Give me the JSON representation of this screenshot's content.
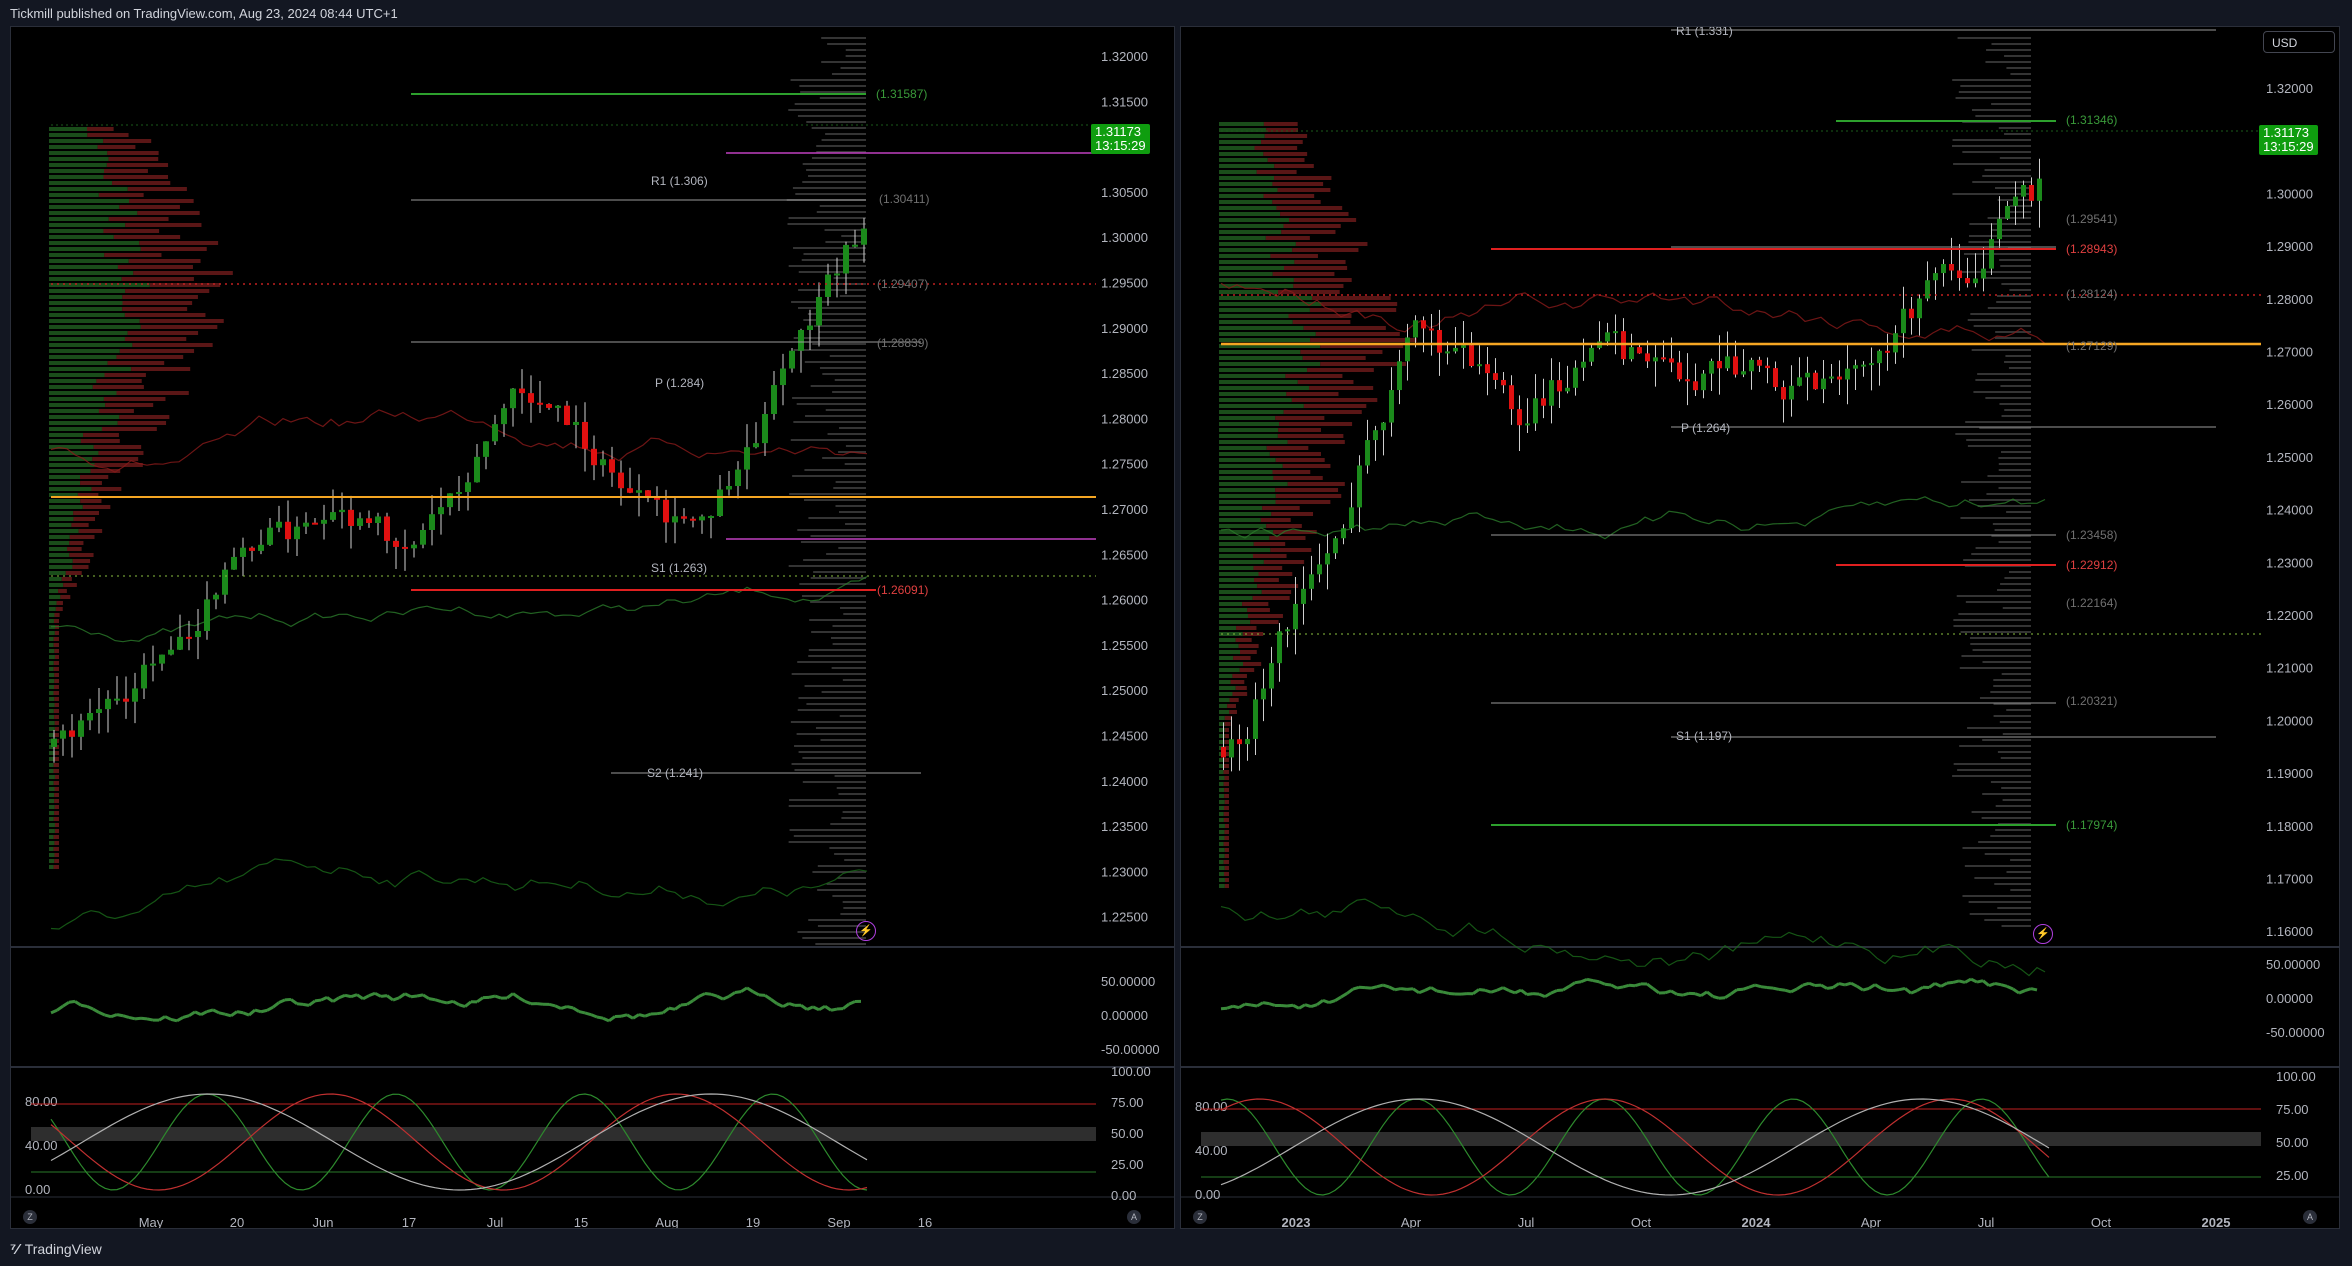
{
  "header": {
    "published": "Tickmill published on TradingView.com, Aug 23, 2024 08:44 UTC+1"
  },
  "footer": {
    "brand": "TradingView",
    "brand_icon": "tv-logo-icon"
  },
  "colors": {
    "bull": "#1b8a1b",
    "bear": "#e01010",
    "accent_orange": "#f5a623",
    "pivot_line": "#b2b5be",
    "magenta": "#c040c0",
    "green_label": "#3a9a3a",
    "red_label": "#e04040"
  },
  "left_chart": {
    "price_axis": [
      "1.32000",
      "1.31500",
      "1.31000",
      "1.30500",
      "1.30000",
      "1.29500",
      "1.29000",
      "1.28500",
      "1.28000",
      "1.27500",
      "1.27000",
      "1.26500",
      "1.26000",
      "1.25500",
      "1.25000",
      "1.24500",
      "1.24000",
      "1.23500",
      "1.23000",
      "1.22500"
    ],
    "last_price": "1.31173",
    "countdown": "13:15:29",
    "levels": [
      {
        "text": "(1.31587)",
        "type": "green"
      },
      {
        "text": "R1 (1.306)",
        "type": "pivot"
      },
      {
        "text": "(1.30411)",
        "type": "grey"
      },
      {
        "text": "(1.29407)",
        "type": "grey"
      },
      {
        "text": "(1.28839)",
        "type": "grey"
      },
      {
        "text": "P (1.284)",
        "type": "pivot"
      },
      {
        "text": "S1 (1.263)",
        "type": "pivot"
      },
      {
        "text": "(1.26091)",
        "type": "red"
      },
      {
        "text": "S2 (1.241)",
        "type": "pivot"
      }
    ],
    "rsi_axis": [
      "50.00000",
      "0.00000",
      "-50.00000"
    ],
    "stoch_axis_right": [
      "100.00",
      "75.00",
      "50.00",
      "25.00",
      "0.00"
    ],
    "stoch_axis_left": [
      "80.00",
      "40.00",
      "0.00"
    ],
    "time_axis": [
      "May",
      "20",
      "Jun",
      "17",
      "Jul",
      "15",
      "Aug",
      "19",
      "Sep",
      "16"
    ],
    "bolt_icon": "lightning-icon"
  },
  "right_chart": {
    "currency_button": "USD",
    "price_axis": [
      "1.32000",
      "1.31000",
      "1.30000",
      "1.29000",
      "1.28000",
      "1.27000",
      "1.26000",
      "1.25000",
      "1.24000",
      "1.23000",
      "1.22000",
      "1.21000",
      "1.20000",
      "1.19000",
      "1.18000",
      "1.17000",
      "1.16000"
    ],
    "last_price": "1.31173",
    "countdown": "13:15:29",
    "levels": [
      {
        "text": "R1 (1.331)",
        "type": "pivot"
      },
      {
        "text": "(1.31346)",
        "type": "green"
      },
      {
        "text": "(1.29541)",
        "type": "grey"
      },
      {
        "text": "(1.28943)",
        "type": "red"
      },
      {
        "text": "(1.28124)",
        "type": "grey"
      },
      {
        "text": "(1.27129)",
        "type": "grey"
      },
      {
        "text": "P (1.264)",
        "type": "pivot"
      },
      {
        "text": "(1.23458)",
        "type": "grey"
      },
      {
        "text": "(1.22912)",
        "type": "red"
      },
      {
        "text": "(1.22164)",
        "type": "grey"
      },
      {
        "text": "(1.20321)",
        "type": "grey"
      },
      {
        "text": "S1 (1.197)",
        "type": "pivot"
      },
      {
        "text": "(1.17974)",
        "type": "green"
      }
    ],
    "rsi_axis": [
      "50.00000",
      "0.00000",
      "-50.00000"
    ],
    "stoch_axis_right": [
      "100.00",
      "75.00",
      "50.00",
      "25.00"
    ],
    "stoch_axis_left": [
      "80.00",
      "40.00",
      "0.00"
    ],
    "time_axis": [
      "2023",
      "Apr",
      "Jul",
      "Oct",
      "2024",
      "Apr",
      "Jul",
      "Oct",
      "2025"
    ],
    "bolt_icon": "lightning-icon"
  }
}
